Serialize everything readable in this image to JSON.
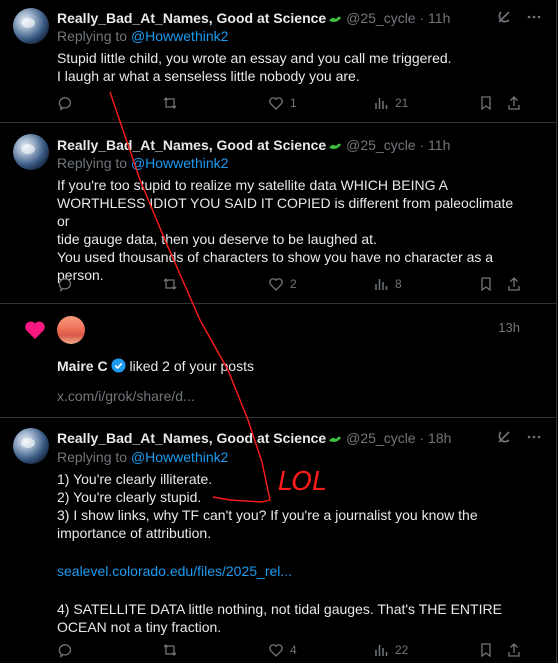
{
  "colors": {
    "accent": "#1d9bf0",
    "muted": "#71767b",
    "text": "#e7e9ea",
    "like": "#f91880",
    "annotation": "#ff1a1a"
  },
  "tweets": [
    {
      "display_name": "Really_Bad_At_Names, Good at Science",
      "handle": "@25_cycle",
      "sep": "·",
      "time": "11h",
      "replying_prefix": "Replying to ",
      "replying_to": "@Howwethink2",
      "lines": [
        "Stupid little child, you wrote an essay and you call me triggered.",
        "I laugh ar what a senseless little nobody you are."
      ],
      "likes": "1",
      "views": "21"
    },
    {
      "display_name": "Really_Bad_At_Names, Good at Science",
      "handle": "@25_cycle",
      "sep": "·",
      "time": "11h",
      "replying_prefix": "Replying to ",
      "replying_to": "@Howwethink2",
      "lines": [
        "If you're too stupid to realize my satellite data WHICH BEING A",
        "WORTHLESS IDIOT YOU SAID IT COPIED is different from paleoclimate or",
        "tide gauge data, then you deserve to be laughed at.",
        "You used thousands of characters to show you have no character as a",
        "person."
      ],
      "likes": "2",
      "views": "8"
    },
    {
      "display_name": "Really_Bad_At_Names, Good at Science",
      "handle": "@25_cycle",
      "sep": "·",
      "time": "18h",
      "replying_prefix": "Replying to ",
      "replying_to": "@Howwethink2",
      "lines": [
        "1) You're clearly illiterate.",
        "2) You're clearly stupid.",
        "3) I show links, why TF can't you? If you're a journalist you know the",
        "importance of attribution."
      ],
      "link": "sealevel.colorado.edu/files/2025_rel...",
      "lines_after": [
        "4) SATELLITE DATA little nothing, not tidal gauges. That's THE ENTIRE",
        "OCEAN not a tiny fraction."
      ],
      "likes": "4",
      "views": "22"
    }
  ],
  "notification": {
    "time": "13h",
    "actor": "Maire C",
    "action_text": " liked 2 of your posts",
    "preview": "x.com/i/grok/share/d..."
  },
  "annotation": {
    "text": "LOL"
  },
  "icons": [
    "grok-icon",
    "more-icon",
    "reply-icon",
    "repost-icon",
    "like-icon",
    "views-icon",
    "bookmark-icon",
    "share-icon",
    "heart-icon",
    "verified-badge-icon",
    "dinosaur-emoji-icon"
  ]
}
